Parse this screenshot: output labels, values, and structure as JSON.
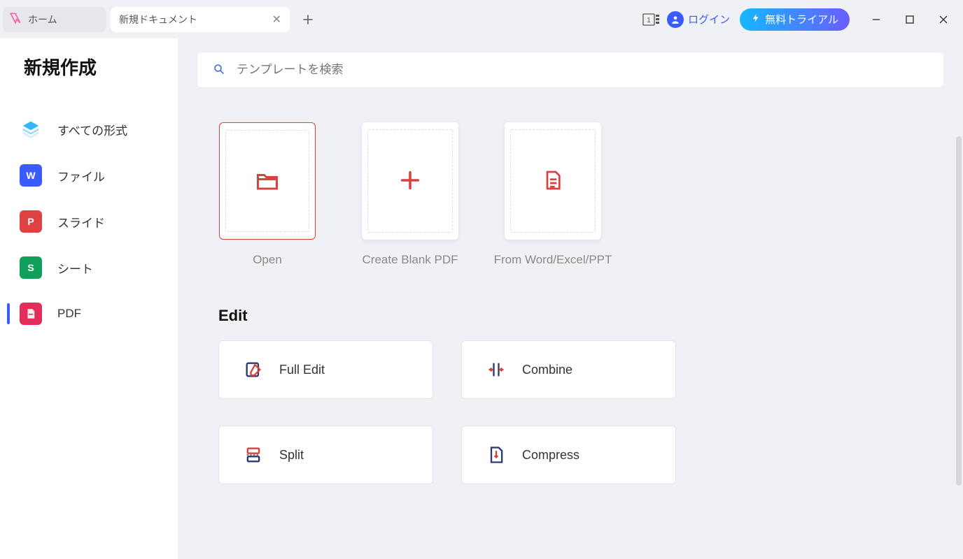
{
  "titlebar": {
    "home_tab": "ホーム",
    "doc_tab": "新規ドキュメント",
    "login": "ログイン",
    "trial": "無料トライアル",
    "mini_count": "1"
  },
  "sidebar": {
    "heading": "新規作成",
    "items": [
      {
        "label": "すべての形式",
        "icon": "layers"
      },
      {
        "label": "ファイル",
        "icon": "W"
      },
      {
        "label": "スライド",
        "icon": "P"
      },
      {
        "label": "シート",
        "icon": "S"
      },
      {
        "label": "PDF",
        "icon": "PDF"
      }
    ]
  },
  "search": {
    "placeholder": "テンプレートを検索"
  },
  "create_cards": [
    {
      "label": "Open"
    },
    {
      "label": "Create Blank PDF"
    },
    {
      "label": "From Word/Excel/PPT"
    }
  ],
  "edit_section": {
    "title": "Edit",
    "actions": [
      {
        "label": "Full Edit"
      },
      {
        "label": "Combine"
      },
      {
        "label": "Split"
      },
      {
        "label": "Compress"
      }
    ]
  }
}
